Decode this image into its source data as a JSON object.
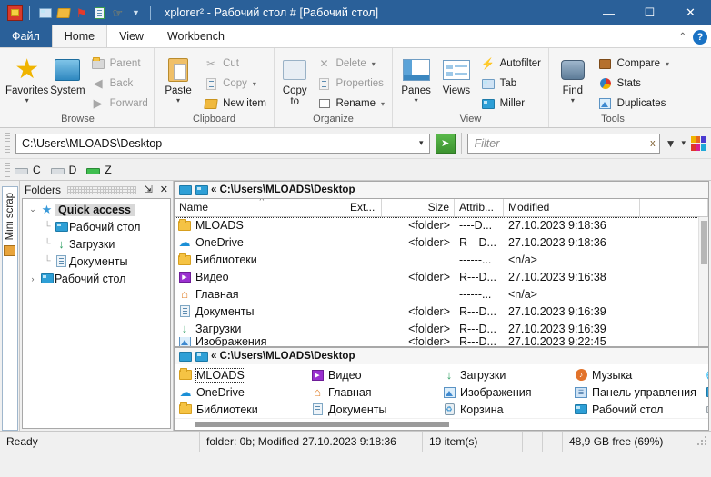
{
  "titlebar": {
    "app_name": "xplorer",
    "app_sup": "2",
    "title": "xplorer² - Рабочий стол # [Рабочий стол]",
    "accent_color": "#2a6099",
    "quick_icons": [
      {
        "name": "app-logo-icon",
        "glyph": "■"
      },
      {
        "name": "folder-icon",
        "glyph": "▤"
      },
      {
        "name": "open-folder-icon",
        "glyph": "▥"
      },
      {
        "name": "flag-icon",
        "glyph": "⚑"
      },
      {
        "name": "refresh-doc-icon",
        "glyph": "↻"
      },
      {
        "name": "thumbs-up-icon",
        "glyph": "☝"
      },
      {
        "name": "dropdown-icon",
        "glyph": "▼"
      }
    ],
    "minimize": "—",
    "maximize": "☐",
    "close": "✕"
  },
  "tabs": {
    "file": "Файл",
    "items": [
      {
        "label": "Home",
        "active": true
      },
      {
        "label": "View",
        "active": false
      },
      {
        "label": "Workbench",
        "active": false
      }
    ],
    "collapse": "⌃",
    "help": "?"
  },
  "ribbon": {
    "groups": [
      {
        "label": "Browse",
        "big": [
          {
            "label": "Favorites",
            "icon": "star-icon",
            "caret": "▾"
          },
          {
            "label": "System",
            "icon": "computer-icon",
            "caret": ""
          }
        ],
        "small": [
          {
            "label": "Parent",
            "icon": "parent-folder-icon",
            "dim": true,
            "caret": ""
          },
          {
            "label": "Back",
            "icon": "back-arrow-icon",
            "dim": true,
            "caret": ""
          },
          {
            "label": "Forward",
            "icon": "forward-arrow-icon",
            "dim": true,
            "caret": ""
          }
        ]
      },
      {
        "label": "Clipboard",
        "big": [
          {
            "label": "Paste",
            "icon": "clipboard-icon",
            "caret": "▾"
          }
        ],
        "small": [
          {
            "label": "Cut",
            "icon": "scissors-icon",
            "dim": true,
            "caret": ""
          },
          {
            "label": "Copy",
            "icon": "copy-icon",
            "dim": true,
            "caret": "▾"
          },
          {
            "label": "New item",
            "icon": "new-item-folder-icon",
            "dim": false,
            "caret": ""
          }
        ]
      },
      {
        "label": "Organize",
        "big": [
          {
            "label": "Copy to",
            "icon": "copy-to-icon",
            "caret": "▾"
          }
        ],
        "small": [
          {
            "label": "Delete",
            "icon": "delete-x-icon",
            "dim": true,
            "caret": "▾"
          },
          {
            "label": "Properties",
            "icon": "properties-icon",
            "dim": true,
            "caret": ""
          },
          {
            "label": "Rename",
            "icon": "rename-icon",
            "dim": false,
            "caret": "▾"
          }
        ]
      },
      {
        "label": "View",
        "big": [
          {
            "label": "Panes",
            "icon": "panes-icon",
            "caret": "▾"
          },
          {
            "label": "Views",
            "icon": "views-icon",
            "caret": ""
          }
        ],
        "small": [
          {
            "label": "Autofilter",
            "icon": "autofilter-icon",
            "dim": false,
            "caret": ""
          },
          {
            "label": "Tab",
            "icon": "tab-folder-icon",
            "dim": false,
            "caret": ""
          },
          {
            "label": "Miller",
            "icon": "miller-columns-icon",
            "dim": false,
            "caret": ""
          }
        ]
      },
      {
        "label": "Tools",
        "big": [
          {
            "label": "Find",
            "icon": "binoculars-icon",
            "caret": "▾"
          }
        ],
        "small": [
          {
            "label": "Compare",
            "icon": "compare-briefcase-icon",
            "dim": false,
            "caret": "▾"
          },
          {
            "label": "Stats",
            "icon": "stats-pie-icon",
            "dim": false,
            "caret": ""
          },
          {
            "label": "Duplicates",
            "icon": "duplicates-icon",
            "dim": false,
            "caret": ""
          }
        ]
      }
    ]
  },
  "addressbar": {
    "path": "C:\\Users\\MLOADS\\Desktop",
    "dropdown": "▾",
    "go": "➡",
    "filter_placeholder": "Filter",
    "filter_value": "",
    "filter_clear": "x",
    "funnel_icon": "▼",
    "funnel_caret": "▾",
    "color_flag_icon": "color-flag-icon",
    "color_flag_colors": [
      "#f0b400",
      "#e0342b",
      "#e8681f",
      "#d71f8e",
      "#3aa836",
      "#1fa8d8"
    ]
  },
  "drivebar": {
    "drives": [
      {
        "letter": "C",
        "icon": "drive-c-icon"
      },
      {
        "letter": "D",
        "icon": "drive-d-icon"
      },
      {
        "letter": "Z",
        "icon": "drive-z-icon"
      }
    ]
  },
  "miniscrap": {
    "label": "Mini scrap",
    "icon": "scrap-panel-icon"
  },
  "tree": {
    "header": "Folders",
    "pin": "⇲",
    "close": "✕",
    "nodes": [
      {
        "label": "Quick access",
        "icon": "quick-access-star-icon",
        "expander": "⌄",
        "level": 0,
        "selected": true
      },
      {
        "label": "Рабочий стол",
        "icon": "desktop-icon",
        "expander": "",
        "level": 1,
        "selected": false
      },
      {
        "label": "Загрузки",
        "icon": "downloads-icon",
        "expander": "",
        "level": 1,
        "selected": false
      },
      {
        "label": "Документы",
        "icon": "documents-icon",
        "expander": "",
        "level": 1,
        "selected": false
      },
      {
        "label": "Рабочий стол",
        "icon": "desktop-icon",
        "expander": "›",
        "level": 0,
        "selected": false
      }
    ]
  },
  "filelist": {
    "breadcrumb": "« C:\\Users\\MLOADS\\Desktop",
    "columns": [
      {
        "label": "Name",
        "key": "name",
        "sorted": true
      },
      {
        "label": "Ext...",
        "key": "ext",
        "sorted": false
      },
      {
        "label": "Size",
        "key": "size",
        "sorted": false
      },
      {
        "label": "Attrib...",
        "key": "attr",
        "sorted": false
      },
      {
        "label": "Modified",
        "key": "mod",
        "sorted": false
      }
    ],
    "rows": [
      {
        "name": "MLOADS",
        "icon": "folder-icon",
        "ext": "",
        "size": "<folder>",
        "attr": "----D...",
        "mod": "27.10.2023 9:18:36",
        "focused": true
      },
      {
        "name": "OneDrive",
        "icon": "onedrive-cloud-icon",
        "ext": "",
        "size": "<folder>",
        "attr": "R---D...",
        "mod": "27.10.2023 9:18:36",
        "focused": false
      },
      {
        "name": "Библиотеки",
        "icon": "folder-icon",
        "ext": "",
        "size": "",
        "attr": "------...",
        "mod": "<n/a>",
        "focused": false
      },
      {
        "name": "Видео",
        "icon": "video-icon",
        "ext": "",
        "size": "<folder>",
        "attr": "R---D...",
        "mod": "27.10.2023 9:16:38",
        "focused": false
      },
      {
        "name": "Главная",
        "icon": "home-icon",
        "ext": "",
        "size": "",
        "attr": "------...",
        "mod": "<n/a>",
        "focused": false
      },
      {
        "name": "Документы",
        "icon": "documents-icon",
        "ext": "",
        "size": "<folder>",
        "attr": "R---D...",
        "mod": "27.10.2023 9:16:39",
        "focused": false
      },
      {
        "name": "Загрузки",
        "icon": "downloads-icon",
        "ext": "",
        "size": "<folder>",
        "attr": "R---D...",
        "mod": "27.10.2023 9:16:39",
        "focused": false
      },
      {
        "name": "Изображения",
        "icon": "pictures-icon",
        "ext": "",
        "size": "<folder>",
        "attr": "R---D...",
        "mod": "27.10.2023 9:22:45",
        "focused": false
      }
    ]
  },
  "bottompane": {
    "breadcrumb": "« C:\\Users\\MLOADS\\Desktop",
    "items": [
      {
        "label": "MLOADS",
        "icon": "folder-icon",
        "focused": true
      },
      {
        "label": "OneDrive",
        "icon": "onedrive-cloud-icon",
        "focused": false
      },
      {
        "label": "Библиотеки",
        "icon": "folder-icon",
        "focused": false
      },
      {
        "label": "Видео",
        "icon": "video-icon",
        "focused": false
      },
      {
        "label": "Главная",
        "icon": "home-icon",
        "focused": false
      },
      {
        "label": "Документы",
        "icon": "documents-icon",
        "focused": false
      },
      {
        "label": "Загрузки",
        "icon": "downloads-icon",
        "focused": false
      },
      {
        "label": "Изображения",
        "icon": "pictures-icon",
        "focused": false
      },
      {
        "label": "Корзина",
        "icon": "recycle-bin-icon",
        "focused": false
      },
      {
        "label": "Музыка",
        "icon": "music-icon",
        "focused": false
      },
      {
        "label": "Панель управления",
        "icon": "control-panel-icon",
        "focused": false
      },
      {
        "label": "Рабочий стол",
        "icon": "desktop-icon",
        "focused": false
      },
      {
        "label": "",
        "icon": "network-icon",
        "focused": false
      },
      {
        "label": "",
        "icon": "computer-monitor-icon",
        "focused": false
      },
      {
        "label": "",
        "icon": "drive-icon",
        "focused": false
      }
    ]
  },
  "statusbar": {
    "state": "Ready",
    "details": "folder: 0b; Modified 27.10.2023 9:18:36",
    "count": "19 item(s)",
    "blank1": "",
    "blank2": "",
    "freespace": "48,9 GB free (69%)"
  }
}
